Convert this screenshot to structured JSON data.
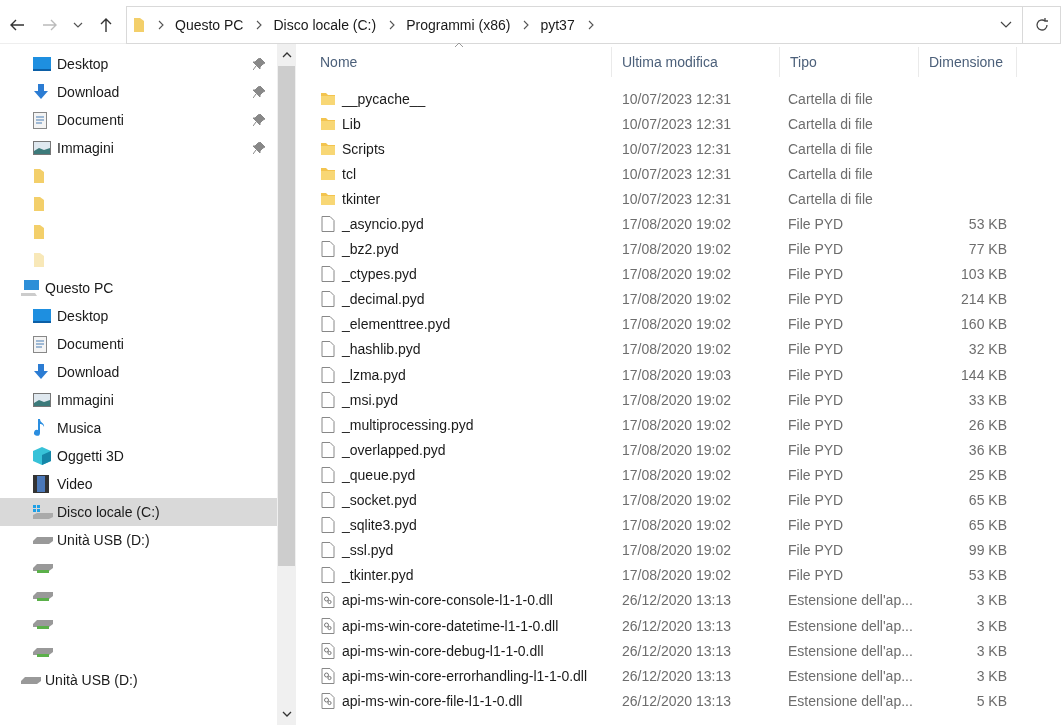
{
  "address_bar": {
    "path": [
      "Questo PC",
      "Disco locale (C:)",
      "Programmi (x86)",
      "pyt37"
    ]
  },
  "sidebar": {
    "items": [
      {
        "label": "Desktop",
        "kind": "desktop",
        "pinned": true,
        "selected": false
      },
      {
        "label": "Download",
        "kind": "download",
        "pinned": true,
        "selected": false
      },
      {
        "label": "Documenti",
        "kind": "documents",
        "pinned": true,
        "selected": false
      },
      {
        "label": "Immagini",
        "kind": "pictures",
        "pinned": true,
        "selected": false
      },
      {
        "kind": "folder",
        "selected": false
      },
      {
        "kind": "folder",
        "selected": false
      },
      {
        "kind": "folder",
        "selected": false
      },
      {
        "kind": "faded",
        "selected": false
      },
      {
        "label": "Questo PC",
        "kind": "pc",
        "selected": false,
        "children": [
          {
            "label": "Desktop",
            "kind": "desktop",
            "selected": false
          },
          {
            "label": "Documenti",
            "kind": "documents",
            "selected": false
          },
          {
            "label": "Download",
            "kind": "download",
            "selected": false
          },
          {
            "label": "Immagini",
            "kind": "pictures",
            "selected": false
          },
          {
            "label": "Musica",
            "kind": "music",
            "selected": false
          },
          {
            "label": "Oggetti 3D",
            "kind": "cube",
            "selected": false
          },
          {
            "label": "Video",
            "kind": "video",
            "selected": false
          },
          {
            "label": "Disco locale (C:)",
            "kind": "system",
            "selected": true
          },
          {
            "label": "Unità USB (D:)",
            "kind": "drive",
            "selected": false
          },
          {
            "kind": "usb",
            "selected": false
          },
          {
            "kind": "usb",
            "selected": false
          },
          {
            "kind": "usb",
            "selected": false
          },
          {
            "kind": "usb",
            "selected": false
          }
        ]
      },
      {
        "label": "Unità USB (D:)",
        "kind": "drive",
        "selected": false
      }
    ]
  },
  "table": {
    "columns": [
      "Nome",
      "Ultima modifica",
      "Tipo",
      "Dimensione"
    ],
    "rows": [
      {
        "kind": "folder",
        "name": "__pycache__",
        "modified": "10/07/2023 12:31",
        "type": "Cartella di file"
      },
      {
        "kind": "folder",
        "name": "Lib",
        "modified": "10/07/2023 12:31",
        "type": "Cartella di file"
      },
      {
        "kind": "folder",
        "name": "Scripts",
        "modified": "10/07/2023 12:31",
        "type": "Cartella di file"
      },
      {
        "kind": "folder",
        "name": "tcl",
        "modified": "10/07/2023 12:31",
        "type": "Cartella di file"
      },
      {
        "kind": "folder",
        "name": "tkinter",
        "modified": "10/07/2023 12:31",
        "type": "Cartella di file"
      },
      {
        "kind": "file",
        "name": "_asyncio.pyd",
        "modified": "17/08/2020 19:02",
        "type": "File PYD",
        "size": "53 KB"
      },
      {
        "kind": "file",
        "name": "_bz2.pyd",
        "modified": "17/08/2020 19:02",
        "type": "File PYD",
        "size": "77 KB"
      },
      {
        "kind": "file",
        "name": "_ctypes.pyd",
        "modified": "17/08/2020 19:02",
        "type": "File PYD",
        "size": "103 KB"
      },
      {
        "kind": "file",
        "name": "_decimal.pyd",
        "modified": "17/08/2020 19:02",
        "type": "File PYD",
        "size": "214 KB"
      },
      {
        "kind": "file",
        "name": "_elementtree.pyd",
        "modified": "17/08/2020 19:02",
        "type": "File PYD",
        "size": "160 KB"
      },
      {
        "kind": "file",
        "name": "_hashlib.pyd",
        "modified": "17/08/2020 19:02",
        "type": "File PYD",
        "size": "32 KB"
      },
      {
        "kind": "file",
        "name": "_lzma.pyd",
        "modified": "17/08/2020 19:03",
        "type": "File PYD",
        "size": "144 KB"
      },
      {
        "kind": "file",
        "name": "_msi.pyd",
        "modified": "17/08/2020 19:02",
        "type": "File PYD",
        "size": "33 KB"
      },
      {
        "kind": "file",
        "name": "_multiprocessing.pyd",
        "modified": "17/08/2020 19:02",
        "type": "File PYD",
        "size": "26 KB"
      },
      {
        "kind": "file",
        "name": "_overlapped.pyd",
        "modified": "17/08/2020 19:02",
        "type": "File PYD",
        "size": "36 KB"
      },
      {
        "kind": "file",
        "name": "_queue.pyd",
        "modified": "17/08/2020 19:02",
        "type": "File PYD",
        "size": "25 KB"
      },
      {
        "kind": "file",
        "name": "_socket.pyd",
        "modified": "17/08/2020 19:02",
        "type": "File PYD",
        "size": "65 KB"
      },
      {
        "kind": "file",
        "name": "_sqlite3.pyd",
        "modified": "17/08/2020 19:02",
        "type": "File PYD",
        "size": "65 KB"
      },
      {
        "kind": "file",
        "name": "_ssl.pyd",
        "modified": "17/08/2020 19:02",
        "type": "File PYD",
        "size": "99 KB"
      },
      {
        "kind": "file",
        "name": "_tkinter.pyd",
        "modified": "17/08/2020 19:02",
        "type": "File PYD",
        "size": "53 KB"
      },
      {
        "kind": "dll",
        "name": "api-ms-win-core-console-l1-1-0.dll",
        "modified": "26/12/2020 13:13",
        "type": "Estensione dell'ap...",
        "size": "3 KB"
      },
      {
        "kind": "dll",
        "name": "api-ms-win-core-datetime-l1-1-0.dll",
        "modified": "26/12/2020 13:13",
        "type": "Estensione dell'ap...",
        "size": "3 KB"
      },
      {
        "kind": "dll",
        "name": "api-ms-win-core-debug-l1-1-0.dll",
        "modified": "26/12/2020 13:13",
        "type": "Estensione dell'ap...",
        "size": "3 KB"
      },
      {
        "kind": "dll",
        "name": "api-ms-win-core-errorhandling-l1-1-0.dll",
        "modified": "26/12/2020 13:13",
        "type": "Estensione dell'ap...",
        "size": "3 KB"
      },
      {
        "kind": "dll",
        "name": "api-ms-win-core-file-l1-1-0.dll",
        "modified": "26/12/2020 13:13",
        "type": "Estensione dell'ap...",
        "size": "5 KB"
      }
    ]
  }
}
